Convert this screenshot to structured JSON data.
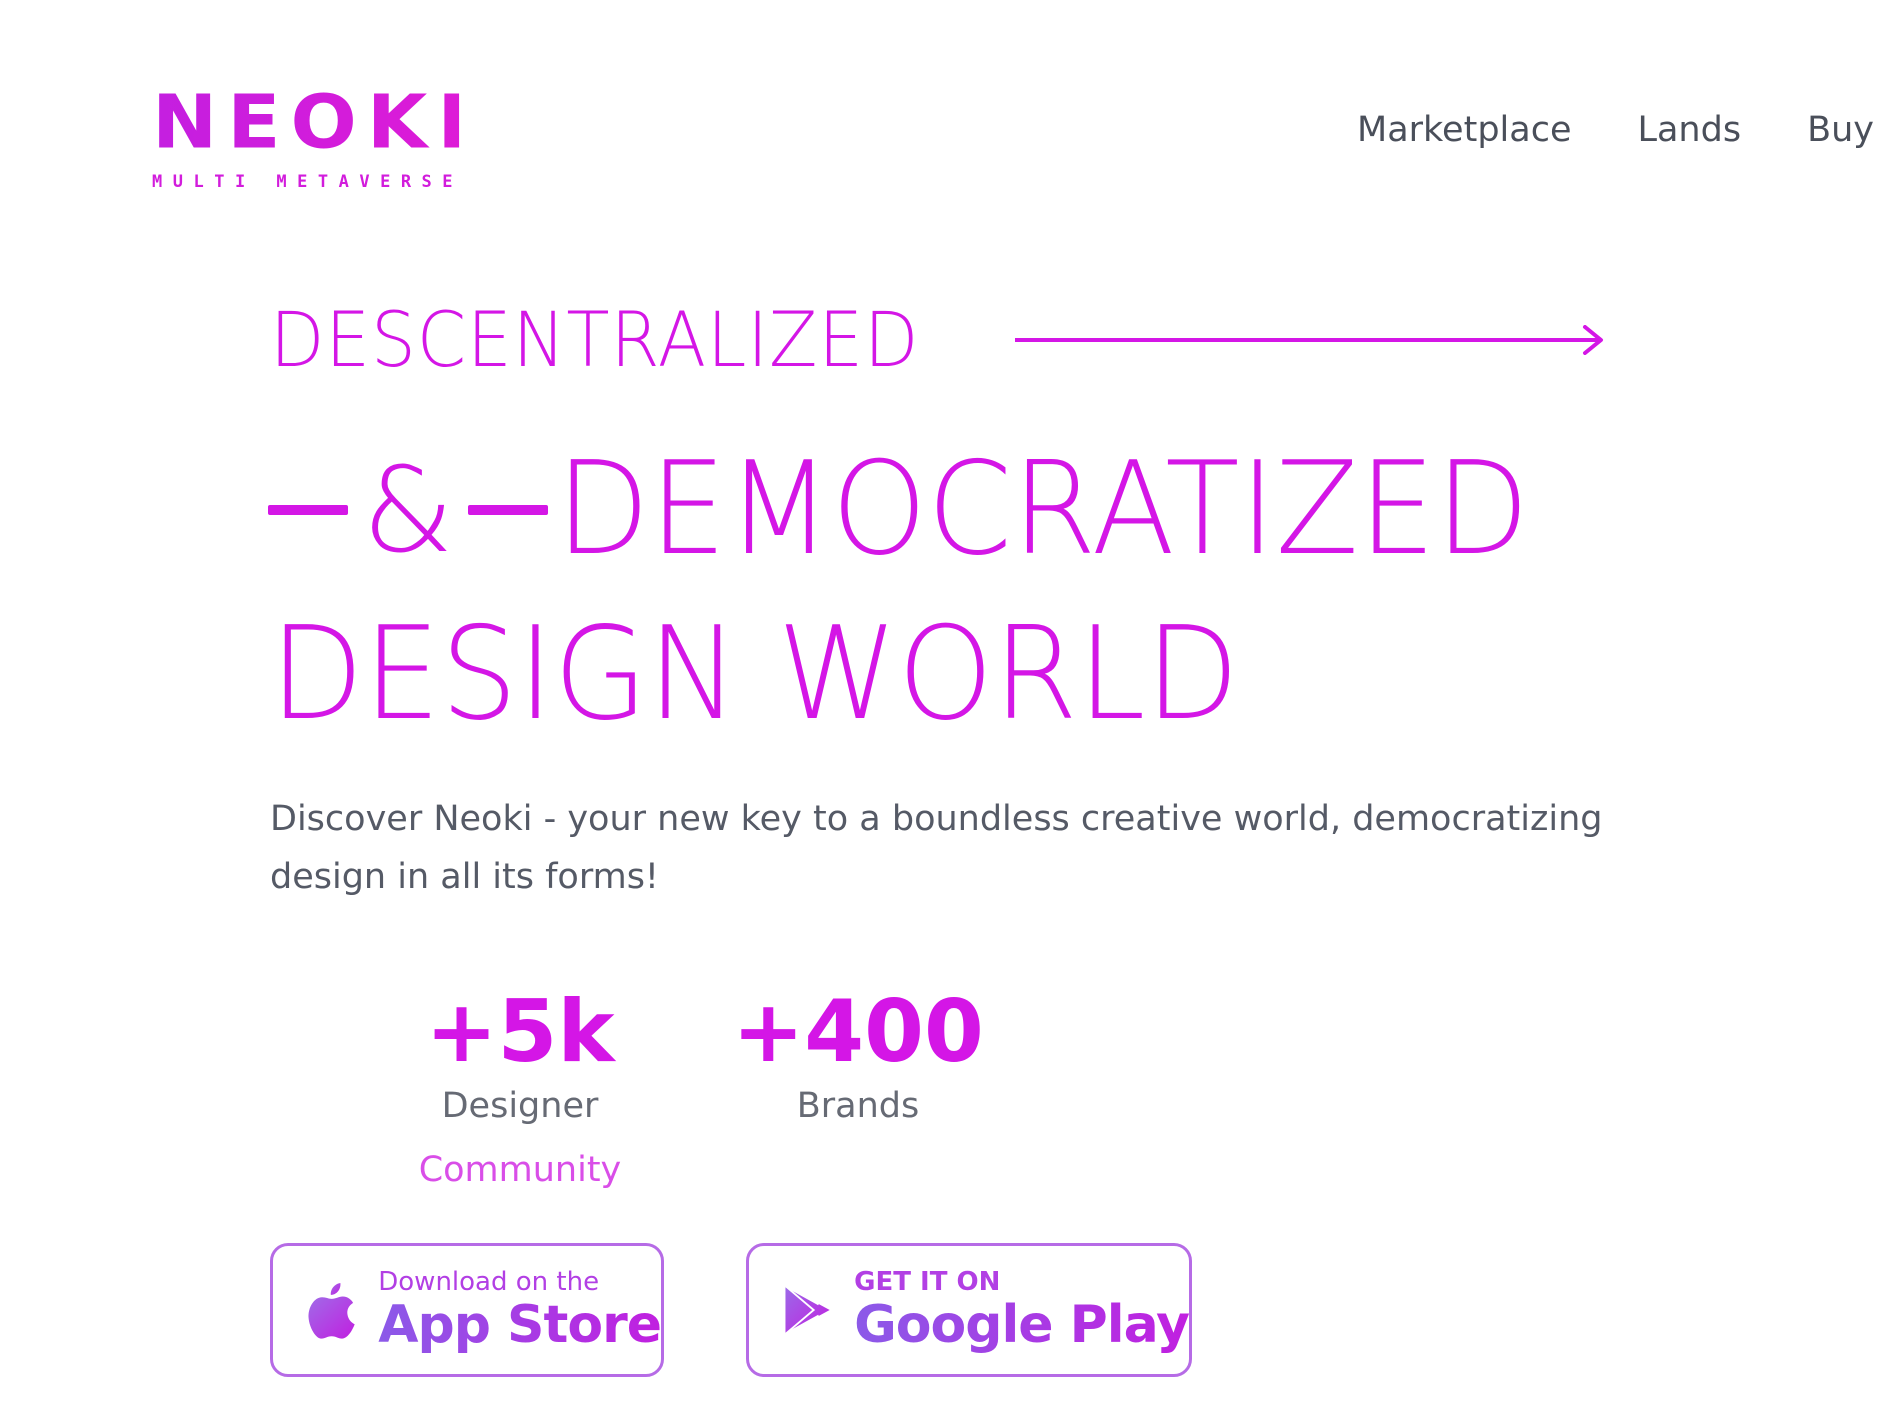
{
  "brand": {
    "logo_text": "NEOKI",
    "tagline": "MULTI METAVERSE"
  },
  "nav": {
    "items": [
      "Marketplace",
      "Lands",
      "Buy"
    ]
  },
  "hero": {
    "line1": "DESCENTRALIZED",
    "ampersand": "&",
    "line2": "DEMOCRATIZED",
    "line3": "DESIGN WORLD",
    "description": "Discover Neoki - your new key to a boundless creative world, democratizing design in all its forms!"
  },
  "stats": [
    {
      "value": "+5k",
      "label": "Designer",
      "sublabel": "Community"
    },
    {
      "value": "+400",
      "label": "Brands"
    }
  ],
  "stores": {
    "apple": {
      "small": "Download on the",
      "big": "App Store",
      "icon": "apple-icon"
    },
    "google": {
      "small": "GET IT ON",
      "big": "Google Play",
      "icon": "play-store-icon"
    }
  },
  "colors": {
    "accent": "#d416e6",
    "text_muted": "#555a66",
    "button_border": "#b66be6"
  }
}
